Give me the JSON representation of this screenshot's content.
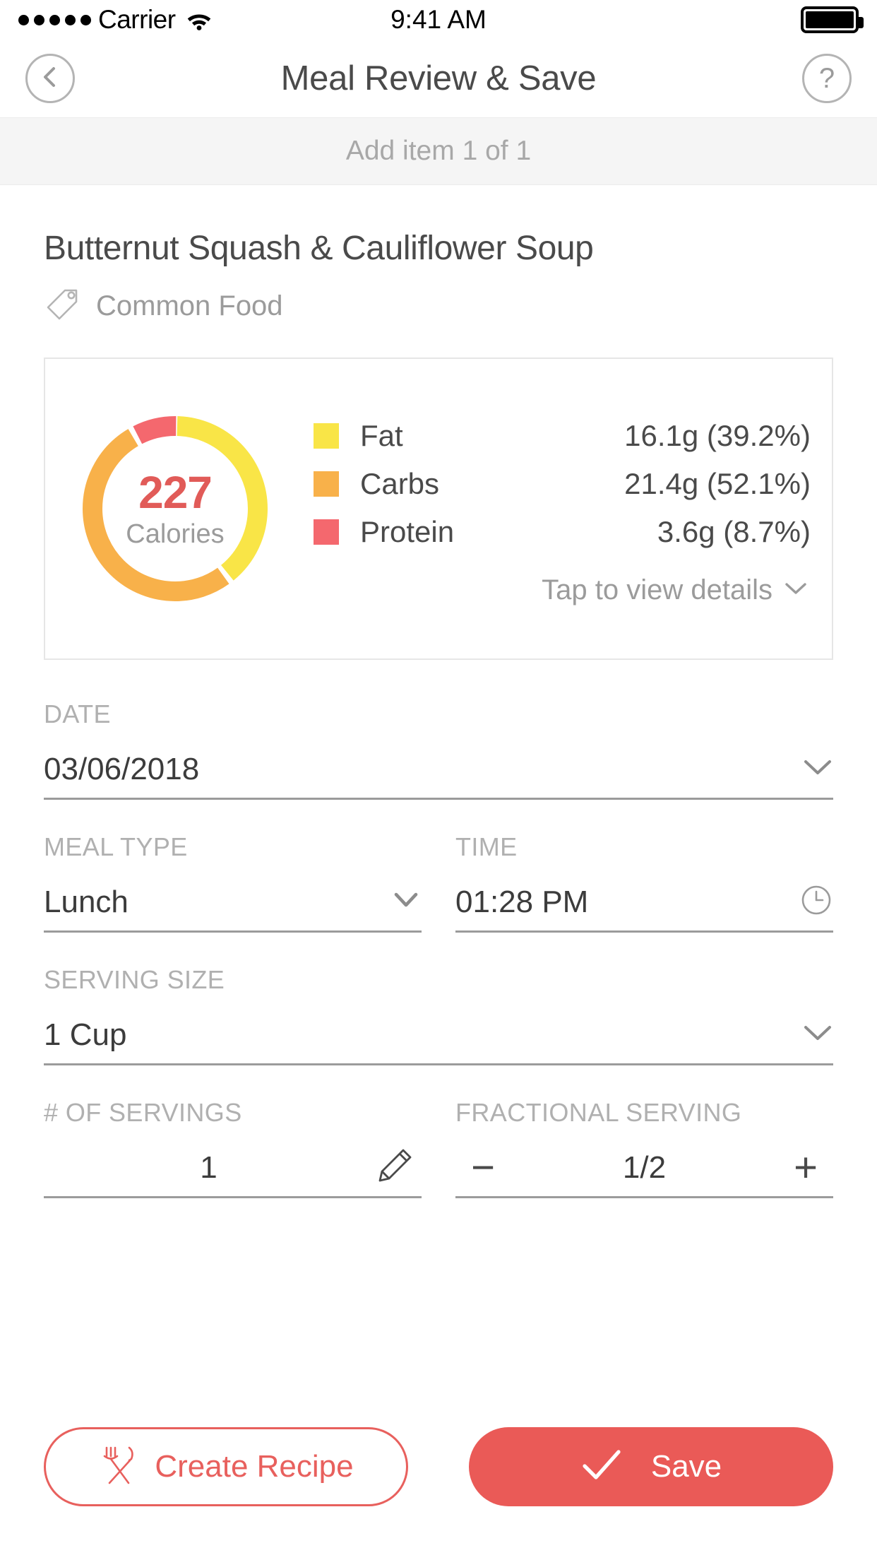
{
  "status_bar": {
    "carrier": "Carrier",
    "signal_dots": 5,
    "wifi_icon": "wifi-icon",
    "time": "9:41 AM",
    "battery_icon": "battery-full-icon"
  },
  "nav": {
    "title": "Meal Review & Save",
    "back_icon": "chevron-left-icon",
    "help_label": "?"
  },
  "subheader": {
    "text": "Add item 1 of 1"
  },
  "food": {
    "name": "Butternut Squash & Cauliflower Soup",
    "tag_icon": "tag-icon",
    "tag_label": "Common Food"
  },
  "nutrition": {
    "calories": "227",
    "calories_label": "Calories",
    "details_link": "Tap to view details",
    "details_chevron_icon": "chevron-down-icon",
    "legend": [
      {
        "name": "Fat",
        "value": "16.1g (39.2%)",
        "color": "#f9e547"
      },
      {
        "name": "Carbs",
        "value": "21.4g (52.1%)",
        "color": "#f8b14a"
      },
      {
        "name": "Protein",
        "value": "3.6g (8.7%)",
        "color": "#f4686e"
      }
    ]
  },
  "chart_data": {
    "type": "pie",
    "title": "Macronutrient breakdown",
    "categories": [
      "Fat",
      "Carbs",
      "Protein"
    ],
    "values": [
      39.2,
      52.1,
      8.7
    ],
    "grams": [
      16.1,
      21.4,
      3.6
    ],
    "units": "%",
    "colors": [
      "#f9e547",
      "#f8b14a",
      "#f4686e"
    ],
    "center_value": "227",
    "center_label": "Calories",
    "donut": true,
    "start_angle_deg": 0,
    "legend_position": "right"
  },
  "form": {
    "date": {
      "label": "DATE",
      "value": "03/06/2018",
      "icon": "chevron-down-icon"
    },
    "meal_type": {
      "label": "MEAL TYPE",
      "value": "Lunch",
      "icon": "chevron-down-icon"
    },
    "time": {
      "label": "TIME",
      "value": "01:28 PM",
      "icon": "clock-icon"
    },
    "serving_size": {
      "label": "SERVING SIZE",
      "value": "1 Cup",
      "icon": "chevron-down-icon"
    },
    "num_servings": {
      "label": "# OF SERVINGS",
      "value": "1",
      "icon": "pencil-icon"
    },
    "fractional_serving": {
      "label": "FRACTIONAL SERVING",
      "value": "1/2",
      "minus": "−",
      "plus": "+"
    }
  },
  "actions": {
    "create_recipe": {
      "label": "Create Recipe",
      "icon": "fork-knife-icon"
    },
    "save": {
      "label": "Save",
      "icon": "check-icon"
    }
  },
  "colors": {
    "accent": "#ea5a57",
    "fat": "#f9e547",
    "carbs": "#f8b14a",
    "protein": "#f4686e"
  }
}
